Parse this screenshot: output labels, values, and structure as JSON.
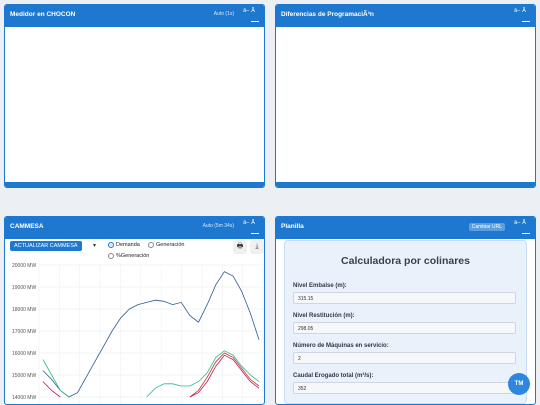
{
  "panels": {
    "medidor": {
      "title": "Medidor en CHOCON",
      "auto": "Auto (1s)"
    },
    "diferencias": {
      "title": "Diferencias de ProgramaciÃ³n"
    },
    "cammesa": {
      "title": "CAMMESA",
      "auto": "Auto (5m 34s)"
    },
    "planilla": {
      "title": "Planilla",
      "url_button": "Cambiar URL"
    }
  },
  "tool_icons": {
    "top": "â– ",
    "accent": "Ã"
  },
  "cammesa_controls": {
    "update_button": "ACTUALIZAR CAMMESA",
    "radio_demanda": "Demanda",
    "radio_generacion": "Generación",
    "radio_pct_generacion": "%Generación",
    "selected": "Demanda"
  },
  "chart_data": {
    "type": "line",
    "y_ticks": [
      "20000 MW",
      "19000 MW",
      "18000 MW",
      "17000 MW",
      "16000 MW",
      "15000 MW",
      "14000 MW"
    ],
    "ylim": [
      14000,
      20000
    ],
    "grid": true,
    "series": [
      {
        "color": "#2e5b8f",
        "values": [
          15200,
          14800,
          14300,
          14000,
          14200,
          14900,
          15600,
          16300,
          17000,
          17600,
          18000,
          18200,
          18300,
          18400,
          18350,
          18200,
          18300,
          17700,
          17400,
          18200,
          19100,
          19700,
          19500,
          18800,
          17800,
          16600
        ]
      },
      {
        "color": "#c0392b",
        "values": [
          null,
          null,
          null,
          null,
          null,
          null,
          null,
          null,
          null,
          null,
          null,
          null,
          null,
          null,
          null,
          null,
          null,
          14000,
          14300,
          14900,
          15600,
          16000,
          15800,
          15300,
          14800,
          14500
        ]
      },
      {
        "color": "#2eb88a",
        "values": [
          15700,
          15000,
          14300,
          14000,
          null,
          null,
          null,
          null,
          null,
          null,
          null,
          null,
          14000,
          14400,
          14600,
          14600,
          14500,
          14500,
          14700,
          15100,
          15800,
          16100,
          15900,
          15400,
          15000,
          14700
        ]
      },
      {
        "color": "#c2185b",
        "values": [
          14700,
          14300,
          14000,
          null,
          null,
          null,
          null,
          null,
          null,
          null,
          null,
          null,
          null,
          null,
          null,
          null,
          null,
          14000,
          14200,
          14700,
          15400,
          15900,
          15700,
          15200,
          14700,
          14400
        ]
      }
    ]
  },
  "planilla": {
    "heading": "Calculadora por colinares",
    "fields": [
      {
        "label": "Nivel Embalse (m):",
        "value": "315.15"
      },
      {
        "label": "Nivel Restitución (m):",
        "value": "298.05"
      },
      {
        "label": "Número de Máquinas en servicio:",
        "value": "2"
      },
      {
        "label": "Caudal Erogado total (m³/s):",
        "value": "352"
      }
    ]
  },
  "fab_label": "TM"
}
